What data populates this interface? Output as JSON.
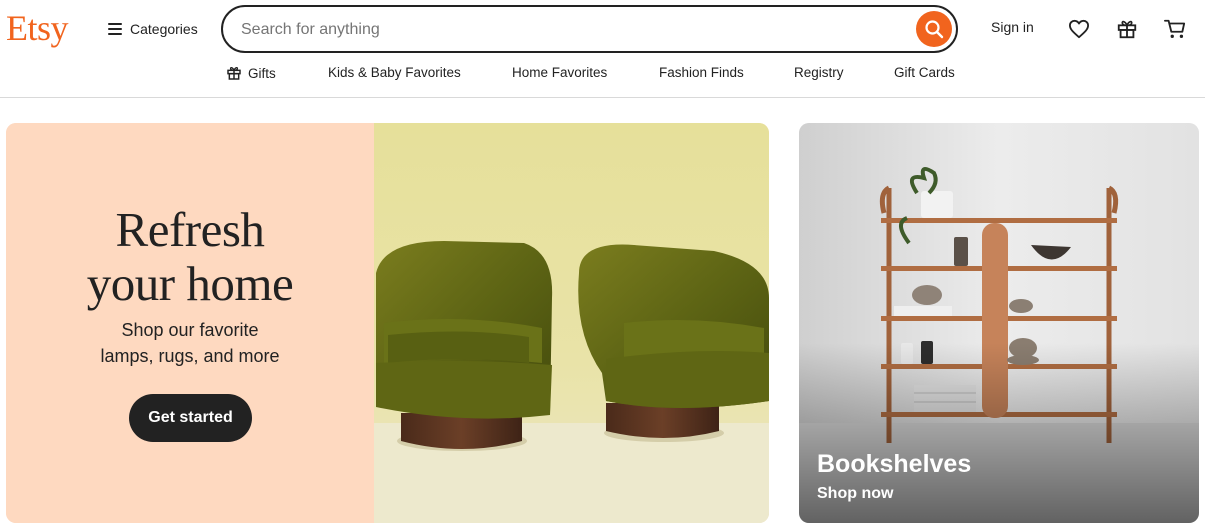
{
  "header": {
    "logo": "Etsy",
    "categories_label": "Categories",
    "search_placeholder": "Search for anything",
    "signin_label": "Sign in",
    "icons": {
      "search": "search-icon",
      "favorites": "heart-icon",
      "gift": "gift-icon",
      "cart": "cart-icon"
    }
  },
  "nav": {
    "items": [
      {
        "label": "Gifts",
        "icon": "gift-icon"
      },
      {
        "label": "Kids & Baby Favorites"
      },
      {
        "label": "Home Favorites"
      },
      {
        "label": "Fashion Finds"
      },
      {
        "label": "Registry"
      },
      {
        "label": "Gift Cards"
      }
    ]
  },
  "hero": {
    "title_line1": "Refresh",
    "title_line2": "your home",
    "subtitle_line1": "Shop our favorite",
    "subtitle_line2": "lamps, rugs, and more",
    "cta": "Get started"
  },
  "side_card": {
    "title": "Bookshelves",
    "link": "Shop now"
  },
  "colors": {
    "brand": "#f1641e",
    "hero_bg": "#fed9c0",
    "text": "#222222"
  }
}
